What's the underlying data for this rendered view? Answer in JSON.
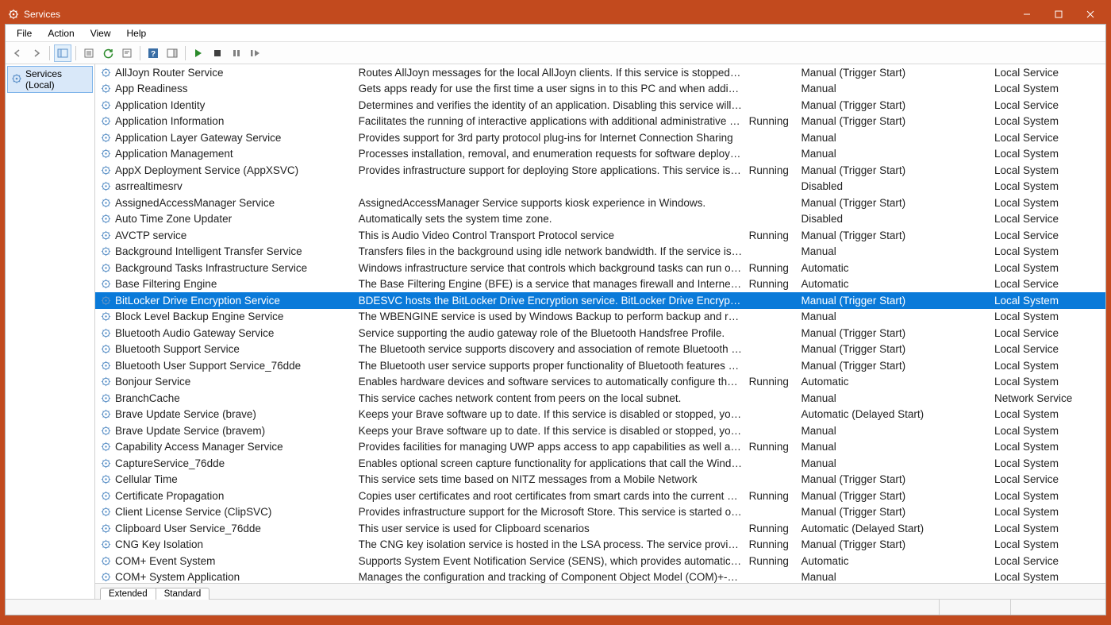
{
  "window": {
    "title": "Services"
  },
  "menubar": {
    "items": [
      "File",
      "Action",
      "View",
      "Help"
    ]
  },
  "tree": {
    "root_label": "Services (Local)"
  },
  "tabs": {
    "extended": "Extended",
    "standard": "Standard"
  },
  "columns": {
    "name_w": 325,
    "desc_w": 485,
    "status_w": 65,
    "startup_w": 240,
    "logon_w": 140
  },
  "services": [
    {
      "name": "AllJoyn Router Service",
      "desc": "Routes AllJoyn messages for the local AllJoyn clients. If this service is stopped the …",
      "status": "",
      "startup": "Manual (Trigger Start)",
      "logon": "Local Service",
      "sel": false
    },
    {
      "name": "App Readiness",
      "desc": "Gets apps ready for use the first time a user signs in to this PC and when adding n…",
      "status": "",
      "startup": "Manual",
      "logon": "Local System",
      "sel": false
    },
    {
      "name": "Application Identity",
      "desc": "Determines and verifies the identity of an application. Disabling this service will pr…",
      "status": "",
      "startup": "Manual (Trigger Start)",
      "logon": "Local Service",
      "sel": false
    },
    {
      "name": "Application Information",
      "desc": "Facilitates the running of interactive applications with additional administrative pr…",
      "status": "Running",
      "startup": "Manual (Trigger Start)",
      "logon": "Local System",
      "sel": false
    },
    {
      "name": "Application Layer Gateway Service",
      "desc": "Provides support for 3rd party protocol plug-ins for Internet Connection Sharing",
      "status": "",
      "startup": "Manual",
      "logon": "Local Service",
      "sel": false
    },
    {
      "name": "Application Management",
      "desc": "Processes installation, removal, and enumeration requests for software deployed t…",
      "status": "",
      "startup": "Manual",
      "logon": "Local System",
      "sel": false
    },
    {
      "name": "AppX Deployment Service (AppXSVC)",
      "desc": "Provides infrastructure support for deploying Store applications. This service is sta…",
      "status": "Running",
      "startup": "Manual (Trigger Start)",
      "logon": "Local System",
      "sel": false
    },
    {
      "name": "asrrealtimesrv",
      "desc": "",
      "status": "",
      "startup": "Disabled",
      "logon": "Local System",
      "sel": false
    },
    {
      "name": "AssignedAccessManager Service",
      "desc": "AssignedAccessManager Service supports kiosk experience in Windows.",
      "status": "",
      "startup": "Manual (Trigger Start)",
      "logon": "Local System",
      "sel": false
    },
    {
      "name": "Auto Time Zone Updater",
      "desc": "Automatically sets the system time zone.",
      "status": "",
      "startup": "Disabled",
      "logon": "Local Service",
      "sel": false
    },
    {
      "name": "AVCTP service",
      "desc": "This is Audio Video Control Transport Protocol service",
      "status": "Running",
      "startup": "Manual (Trigger Start)",
      "logon": "Local Service",
      "sel": false
    },
    {
      "name": "Background Intelligent Transfer Service",
      "desc": "Transfers files in the background using idle network bandwidth. If the service is dis…",
      "status": "",
      "startup": "Manual",
      "logon": "Local System",
      "sel": false
    },
    {
      "name": "Background Tasks Infrastructure Service",
      "desc": "Windows infrastructure service that controls which background tasks can run on t…",
      "status": "Running",
      "startup": "Automatic",
      "logon": "Local System",
      "sel": false
    },
    {
      "name": "Base Filtering Engine",
      "desc": "The Base Filtering Engine (BFE) is a service that manages firewall and Internet Prot…",
      "status": "Running",
      "startup": "Automatic",
      "logon": "Local Service",
      "sel": false
    },
    {
      "name": "BitLocker Drive Encryption Service",
      "desc": "BDESVC hosts the BitLocker Drive Encryption service. BitLocker Drive Encryption pr…",
      "status": "",
      "startup": "Manual (Trigger Start)",
      "logon": "Local System",
      "sel": true
    },
    {
      "name": "Block Level Backup Engine Service",
      "desc": "The WBENGINE service is used by Windows Backup to perform backup and recove…",
      "status": "",
      "startup": "Manual",
      "logon": "Local System",
      "sel": false
    },
    {
      "name": "Bluetooth Audio Gateway Service",
      "desc": "Service supporting the audio gateway role of the Bluetooth Handsfree Profile.",
      "status": "",
      "startup": "Manual (Trigger Start)",
      "logon": "Local Service",
      "sel": false
    },
    {
      "name": "Bluetooth Support Service",
      "desc": "The Bluetooth service supports discovery and association of remote Bluetooth de…",
      "status": "",
      "startup": "Manual (Trigger Start)",
      "logon": "Local Service",
      "sel": false
    },
    {
      "name": "Bluetooth User Support Service_76dde",
      "desc": "The Bluetooth user service supports proper functionality of Bluetooth features rel…",
      "status": "",
      "startup": "Manual (Trigger Start)",
      "logon": "Local System",
      "sel": false
    },
    {
      "name": "Bonjour Service",
      "desc": "Enables hardware devices and software services to automatically configure themse…",
      "status": "Running",
      "startup": "Automatic",
      "logon": "Local System",
      "sel": false
    },
    {
      "name": "BranchCache",
      "desc": "This service caches network content from peers on the local subnet.",
      "status": "",
      "startup": "Manual",
      "logon": "Network Service",
      "sel": false
    },
    {
      "name": "Brave Update Service (brave)",
      "desc": "Keeps your Brave software up to date. If this service is disabled or stopped, your B…",
      "status": "",
      "startup": "Automatic (Delayed Start)",
      "logon": "Local System",
      "sel": false
    },
    {
      "name": "Brave Update Service (bravem)",
      "desc": "Keeps your Brave software up to date. If this service is disabled or stopped, your B…",
      "status": "",
      "startup": "Manual",
      "logon": "Local System",
      "sel": false
    },
    {
      "name": "Capability Access Manager Service",
      "desc": "Provides facilities for managing UWP apps access to app capabilities as well as che…",
      "status": "Running",
      "startup": "Manual",
      "logon": "Local System",
      "sel": false
    },
    {
      "name": "CaptureService_76dde",
      "desc": "Enables optional screen capture functionality for applications that call the Windo…",
      "status": "",
      "startup": "Manual",
      "logon": "Local System",
      "sel": false
    },
    {
      "name": "Cellular Time",
      "desc": "This service sets time based on NITZ messages from a Mobile Network",
      "status": "",
      "startup": "Manual (Trigger Start)",
      "logon": "Local Service",
      "sel": false
    },
    {
      "name": "Certificate Propagation",
      "desc": "Copies user certificates and root certificates from smart cards into the current user'…",
      "status": "Running",
      "startup": "Manual (Trigger Start)",
      "logon": "Local System",
      "sel": false
    },
    {
      "name": "Client License Service (ClipSVC)",
      "desc": "Provides infrastructure support for the Microsoft Store. This service is started on d…",
      "status": "",
      "startup": "Manual (Trigger Start)",
      "logon": "Local System",
      "sel": false
    },
    {
      "name": "Clipboard User Service_76dde",
      "desc": "This user service is used for Clipboard scenarios",
      "status": "Running",
      "startup": "Automatic (Delayed Start)",
      "logon": "Local System",
      "sel": false
    },
    {
      "name": "CNG Key Isolation",
      "desc": "The CNG key isolation service is hosted in the LSA process. The service provides ke…",
      "status": "Running",
      "startup": "Manual (Trigger Start)",
      "logon": "Local System",
      "sel": false
    },
    {
      "name": "COM+ Event System",
      "desc": "Supports System Event Notification Service (SENS), which provides automatic distri…",
      "status": "Running",
      "startup": "Automatic",
      "logon": "Local Service",
      "sel": false
    },
    {
      "name": "COM+ System Application",
      "desc": "Manages the configuration and tracking of Component Object Model (COM)+-ba…",
      "status": "",
      "startup": "Manual",
      "logon": "Local System",
      "sel": false
    }
  ]
}
